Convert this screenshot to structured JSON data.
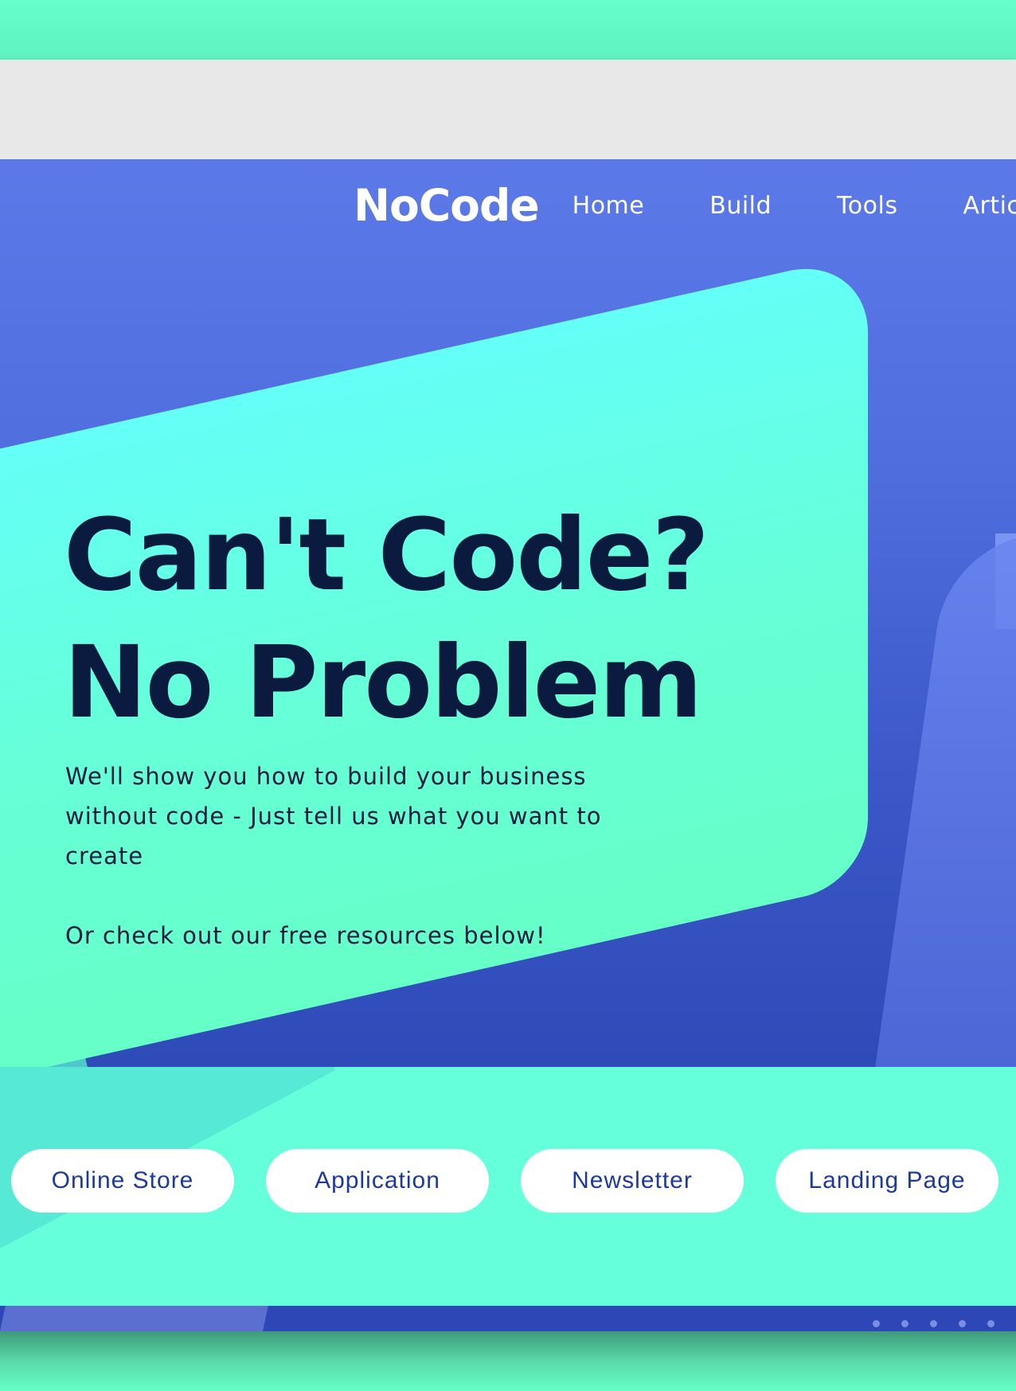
{
  "brand": {
    "logo": "NoCode"
  },
  "nav": {
    "items": [
      "Home",
      "Build",
      "Tools",
      "Artic"
    ]
  },
  "hero": {
    "headline_line1": "Can't Code?",
    "headline_line2": "No Problem",
    "subtext": "We'll show you how to build your business without code - Just tell us what you want to create",
    "subtext2": "Or check out our free resources below!"
  },
  "categories": [
    "Online Store",
    "Application",
    "Newsletter",
    "Landing Page"
  ],
  "colors": {
    "accent_teal": "#66ffc8",
    "hero_blue": "#4f6ddd",
    "headline_navy": "#0b1b3f",
    "pill_text": "#1c3a9e"
  }
}
